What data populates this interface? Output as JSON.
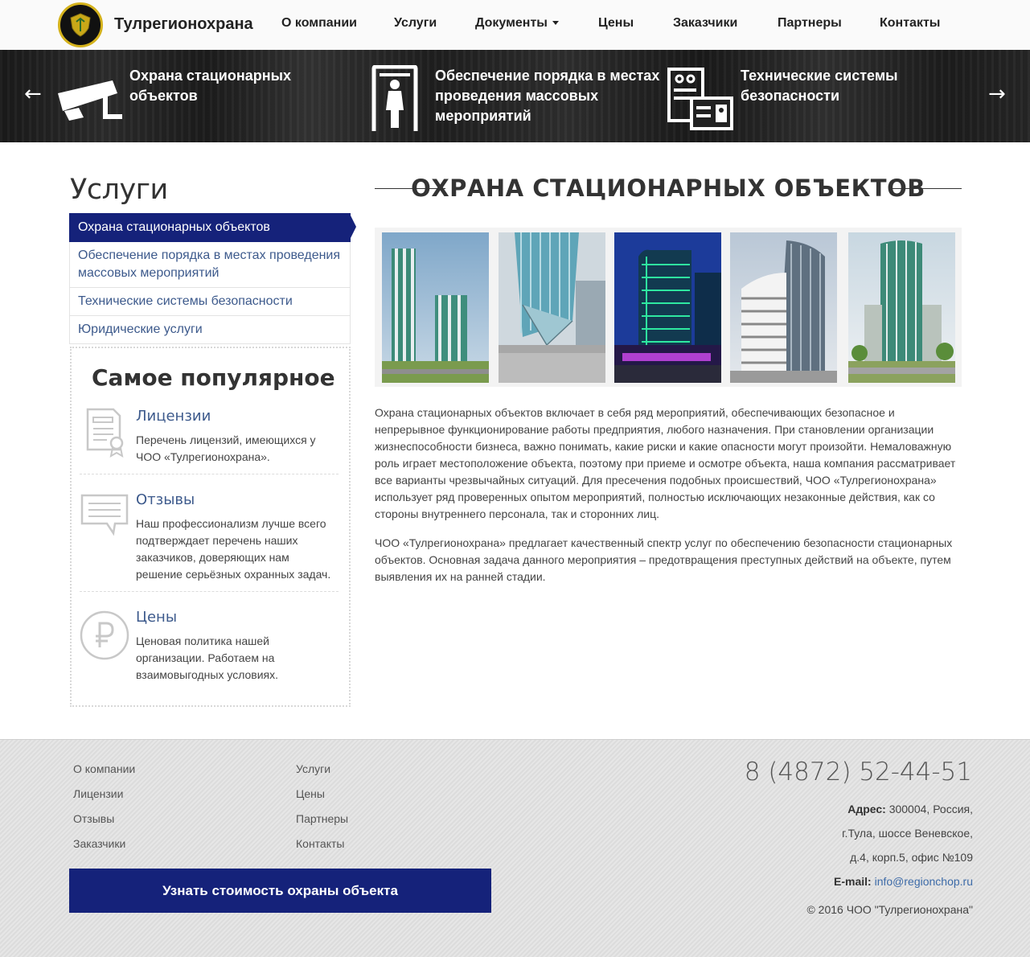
{
  "header": {
    "logo_text": "Тулрегионохрана",
    "nav": [
      {
        "label": "О компании"
      },
      {
        "label": "Услуги"
      },
      {
        "label": "Документы"
      },
      {
        "label": "Цены"
      },
      {
        "label": "Заказчики"
      },
      {
        "label": "Партнеры"
      },
      {
        "label": "Контакты"
      }
    ]
  },
  "banner": {
    "prev_arrow": "←",
    "next_arrow": "→",
    "slides": [
      {
        "text": "Охрана стационарных объектов",
        "icon": "cctv-camera-icon"
      },
      {
        "text": "Обеспечение порядка в местах проведения массовых мероприятий",
        "icon": "metal-detector-icon"
      },
      {
        "text": "Технические системы безопасности",
        "icon": "access-card-icon"
      }
    ]
  },
  "sidebar": {
    "title": "Услуги",
    "menu": [
      {
        "label": "Охрана стационарных объектов",
        "active": true
      },
      {
        "label": "Обеспечение порядка в местах проведения массовых мероприятий"
      },
      {
        "label": "Технические системы безопасности"
      },
      {
        "label": "Юридические услуги"
      }
    ],
    "popular": {
      "title": "Самое популярное",
      "items": [
        {
          "title": "Лицензии",
          "text": "Перечень лицензий, имеющихся у ЧОО «Тулрегионохрана».",
          "icon": "certificate-icon"
        },
        {
          "title": "Отзывы",
          "text": "Наш профессионализм лучше всего подтверждает перечень наших заказчиков, доверяющих нам решение серьёзных охранных задач.",
          "icon": "speech-bubble-icon"
        },
        {
          "title": "Цены",
          "text": "Ценовая политика нашей организации. Работаем на взаимовыгодных условиях.",
          "icon": "ruble-icon"
        }
      ]
    }
  },
  "main": {
    "title": "ОХРАНА СТАЦИОНАРНЫХ ОБЪЕКТОВ",
    "gallery": [
      {
        "image": "building-photo-1"
      },
      {
        "image": "building-photo-2"
      },
      {
        "image": "building-photo-3"
      },
      {
        "image": "building-photo-4"
      },
      {
        "image": "building-photo-5"
      }
    ],
    "paragraphs": [
      "Охрана стационарных объектов включает в себя ряд мероприятий, обеспечивающих безопасное и непрерывное функционирование работы предприятия, любого назначения. При становлении организации жизнеспособности бизнеса, важно понимать, какие риски и какие опасности могут произойти. Немаловажную роль играет местоположение объекта, поэтому при приеме и осмотре объекта, наша компания рассматривает все варианты чрезвычайных ситуаций. Для пресечения подобных происшествий, ЧОО «Тулрегионохрана» использует ряд проверенных опытом мероприятий, полностью исключающих незаконные действия, как со стороны внутреннего персонала, так и сторонних лиц.",
      "ЧОО «Тулрегионохрана» предлагает качественный спектр услуг по обеспечению безопасности стационарных объектов. Основная задача данного мероприятия – предотвращения преступных действий на объекте, путем выявления их на ранней стадии."
    ]
  },
  "footer": {
    "col1": [
      "О компании",
      "Лицензии",
      "Отзывы",
      "Заказчики"
    ],
    "col2": [
      "Услуги",
      "Цены",
      "Партнеры",
      "Контакты"
    ],
    "cta_button": "Узнать стоимость охраны объекта",
    "phone": "8 (4872) 52-44-51",
    "address_label": "Адрес:",
    "address_line1": "300004, Россия,",
    "address_line2": "г.Тула, шоссе Веневское,",
    "address_line3": "д.4, корп.5, офис №109",
    "email_label": "E-mail:",
    "email": "info@regionchop.ru",
    "copyright": "© 2016 ЧОО \"Тулрегионохрана\""
  },
  "colors": {
    "accent": "#15227a",
    "link": "#3d5a8c",
    "banner": "#222222",
    "logo_ring": "#d4b21c"
  }
}
